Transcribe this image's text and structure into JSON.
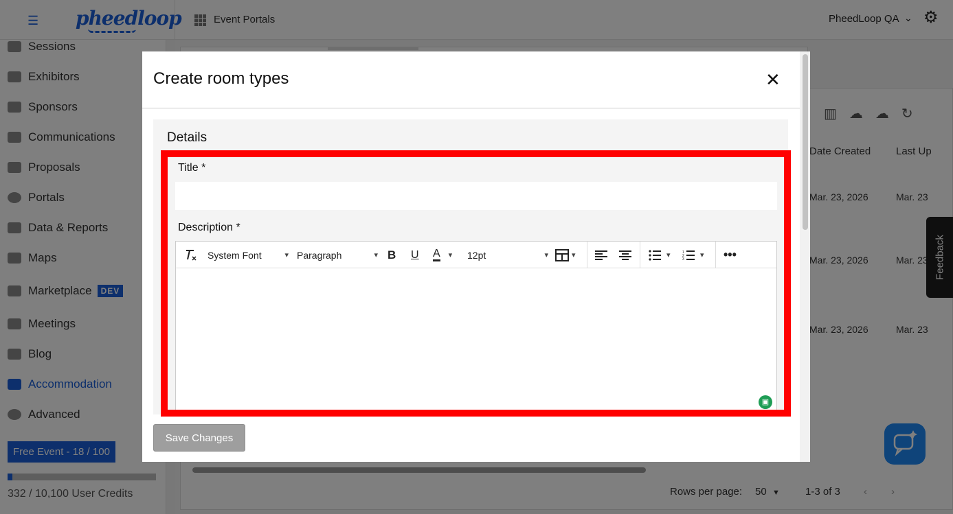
{
  "topbar": {
    "logo_text": "pheedloop",
    "breadcrumb": "Event Portals",
    "org_name": "PheedLoop QA"
  },
  "sidebar": {
    "items": [
      {
        "label": "Sessions"
      },
      {
        "label": "Exhibitors"
      },
      {
        "label": "Sponsors"
      },
      {
        "label": "Communications"
      },
      {
        "label": "Proposals"
      },
      {
        "label": "Portals"
      },
      {
        "label": "Data & Reports"
      },
      {
        "label": "Maps"
      },
      {
        "label": "Marketplace",
        "badge": "DEV"
      },
      {
        "label": "Meetings"
      },
      {
        "label": "Blog"
      },
      {
        "label": "Accommodation",
        "active": true
      },
      {
        "label": "Advanced"
      }
    ],
    "plan_badge": "Free Event - 18 / 100",
    "credits_text": "332 / 10,100 User Credits",
    "credits_fraction": 0.033
  },
  "table": {
    "columns": [
      "Date Created",
      "Last Up"
    ],
    "rows": [
      [
        "Mar. 23, 2026",
        "Mar. 23"
      ],
      [
        "Mar. 23, 2026",
        "Mar. 23"
      ],
      [
        "Mar. 23, 2026",
        "Mar. 23"
      ]
    ],
    "rows_per_page_label": "Rows per page:",
    "rows_per_page_value": "50",
    "range_text": "1-3 of 3"
  },
  "feedback_label": "Feedback",
  "modal": {
    "title": "Create room types",
    "close_glyph": "✕",
    "section_title": "Details",
    "title_label": "Title *",
    "title_value": "",
    "description_label": "Description *",
    "editor": {
      "font_family": "System Font",
      "block_format": "Paragraph",
      "font_size": "12pt"
    },
    "save_label": "Save Changes"
  },
  "colors": {
    "accent": "#1a5fd8",
    "highlight": "#ff0000",
    "chat": "#1e88f5"
  }
}
